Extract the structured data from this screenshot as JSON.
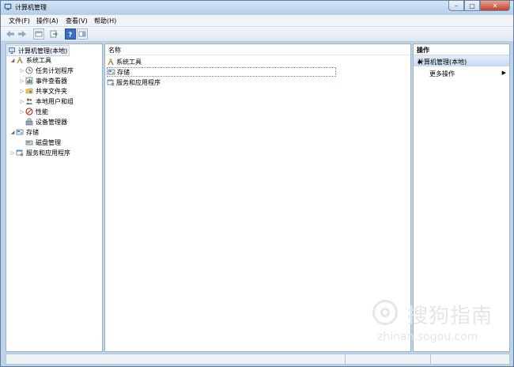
{
  "window": {
    "title": "计算机管理",
    "buttons": {
      "minimize": "–",
      "maximize": "□",
      "close": "✕"
    }
  },
  "menubar": {
    "items": [
      "文件(F)",
      "操作(A)",
      "查看(V)",
      "帮助(H)"
    ]
  },
  "tree": {
    "root": "计算机管理(本地)",
    "items": [
      {
        "label": "系统工具",
        "arrow": "◢",
        "icon": "tools-icon"
      },
      {
        "label": "任务计划程序",
        "arrow": "▷",
        "icon": "clock-icon"
      },
      {
        "label": "事件查看器",
        "arrow": "▷",
        "icon": "event-viewer-icon"
      },
      {
        "label": "共享文件夹",
        "arrow": "▷",
        "icon": "shared-folder-icon"
      },
      {
        "label": "本地用户和组",
        "arrow": "▷",
        "icon": "users-icon"
      },
      {
        "label": "性能",
        "arrow": "▷",
        "icon": "performance-icon"
      },
      {
        "label": "设备管理器",
        "arrow": "",
        "icon": "device-manager-icon"
      },
      {
        "label": "存储",
        "arrow": "◢",
        "icon": "storage-icon"
      },
      {
        "label": "磁盘管理",
        "arrow": "",
        "icon": "disk-icon"
      },
      {
        "label": "服务和应用程序",
        "arrow": "▷",
        "icon": "services-icon"
      }
    ]
  },
  "list": {
    "column_name": "名称",
    "rows": [
      "系统工具",
      "存储",
      "服务和应用程序"
    ]
  },
  "actions": {
    "header": "操作",
    "group": "计算机管理(本地)",
    "group_toggle": "▲",
    "more": "更多操作",
    "more_arrow": "▶"
  },
  "watermark": {
    "text": "搜狗指南",
    "url": "zhinan.sogou.com"
  },
  "colors": {
    "titlebar": "#c5dbf1",
    "close_button": "#c2412a",
    "selection_border": "#6e8bb0"
  }
}
